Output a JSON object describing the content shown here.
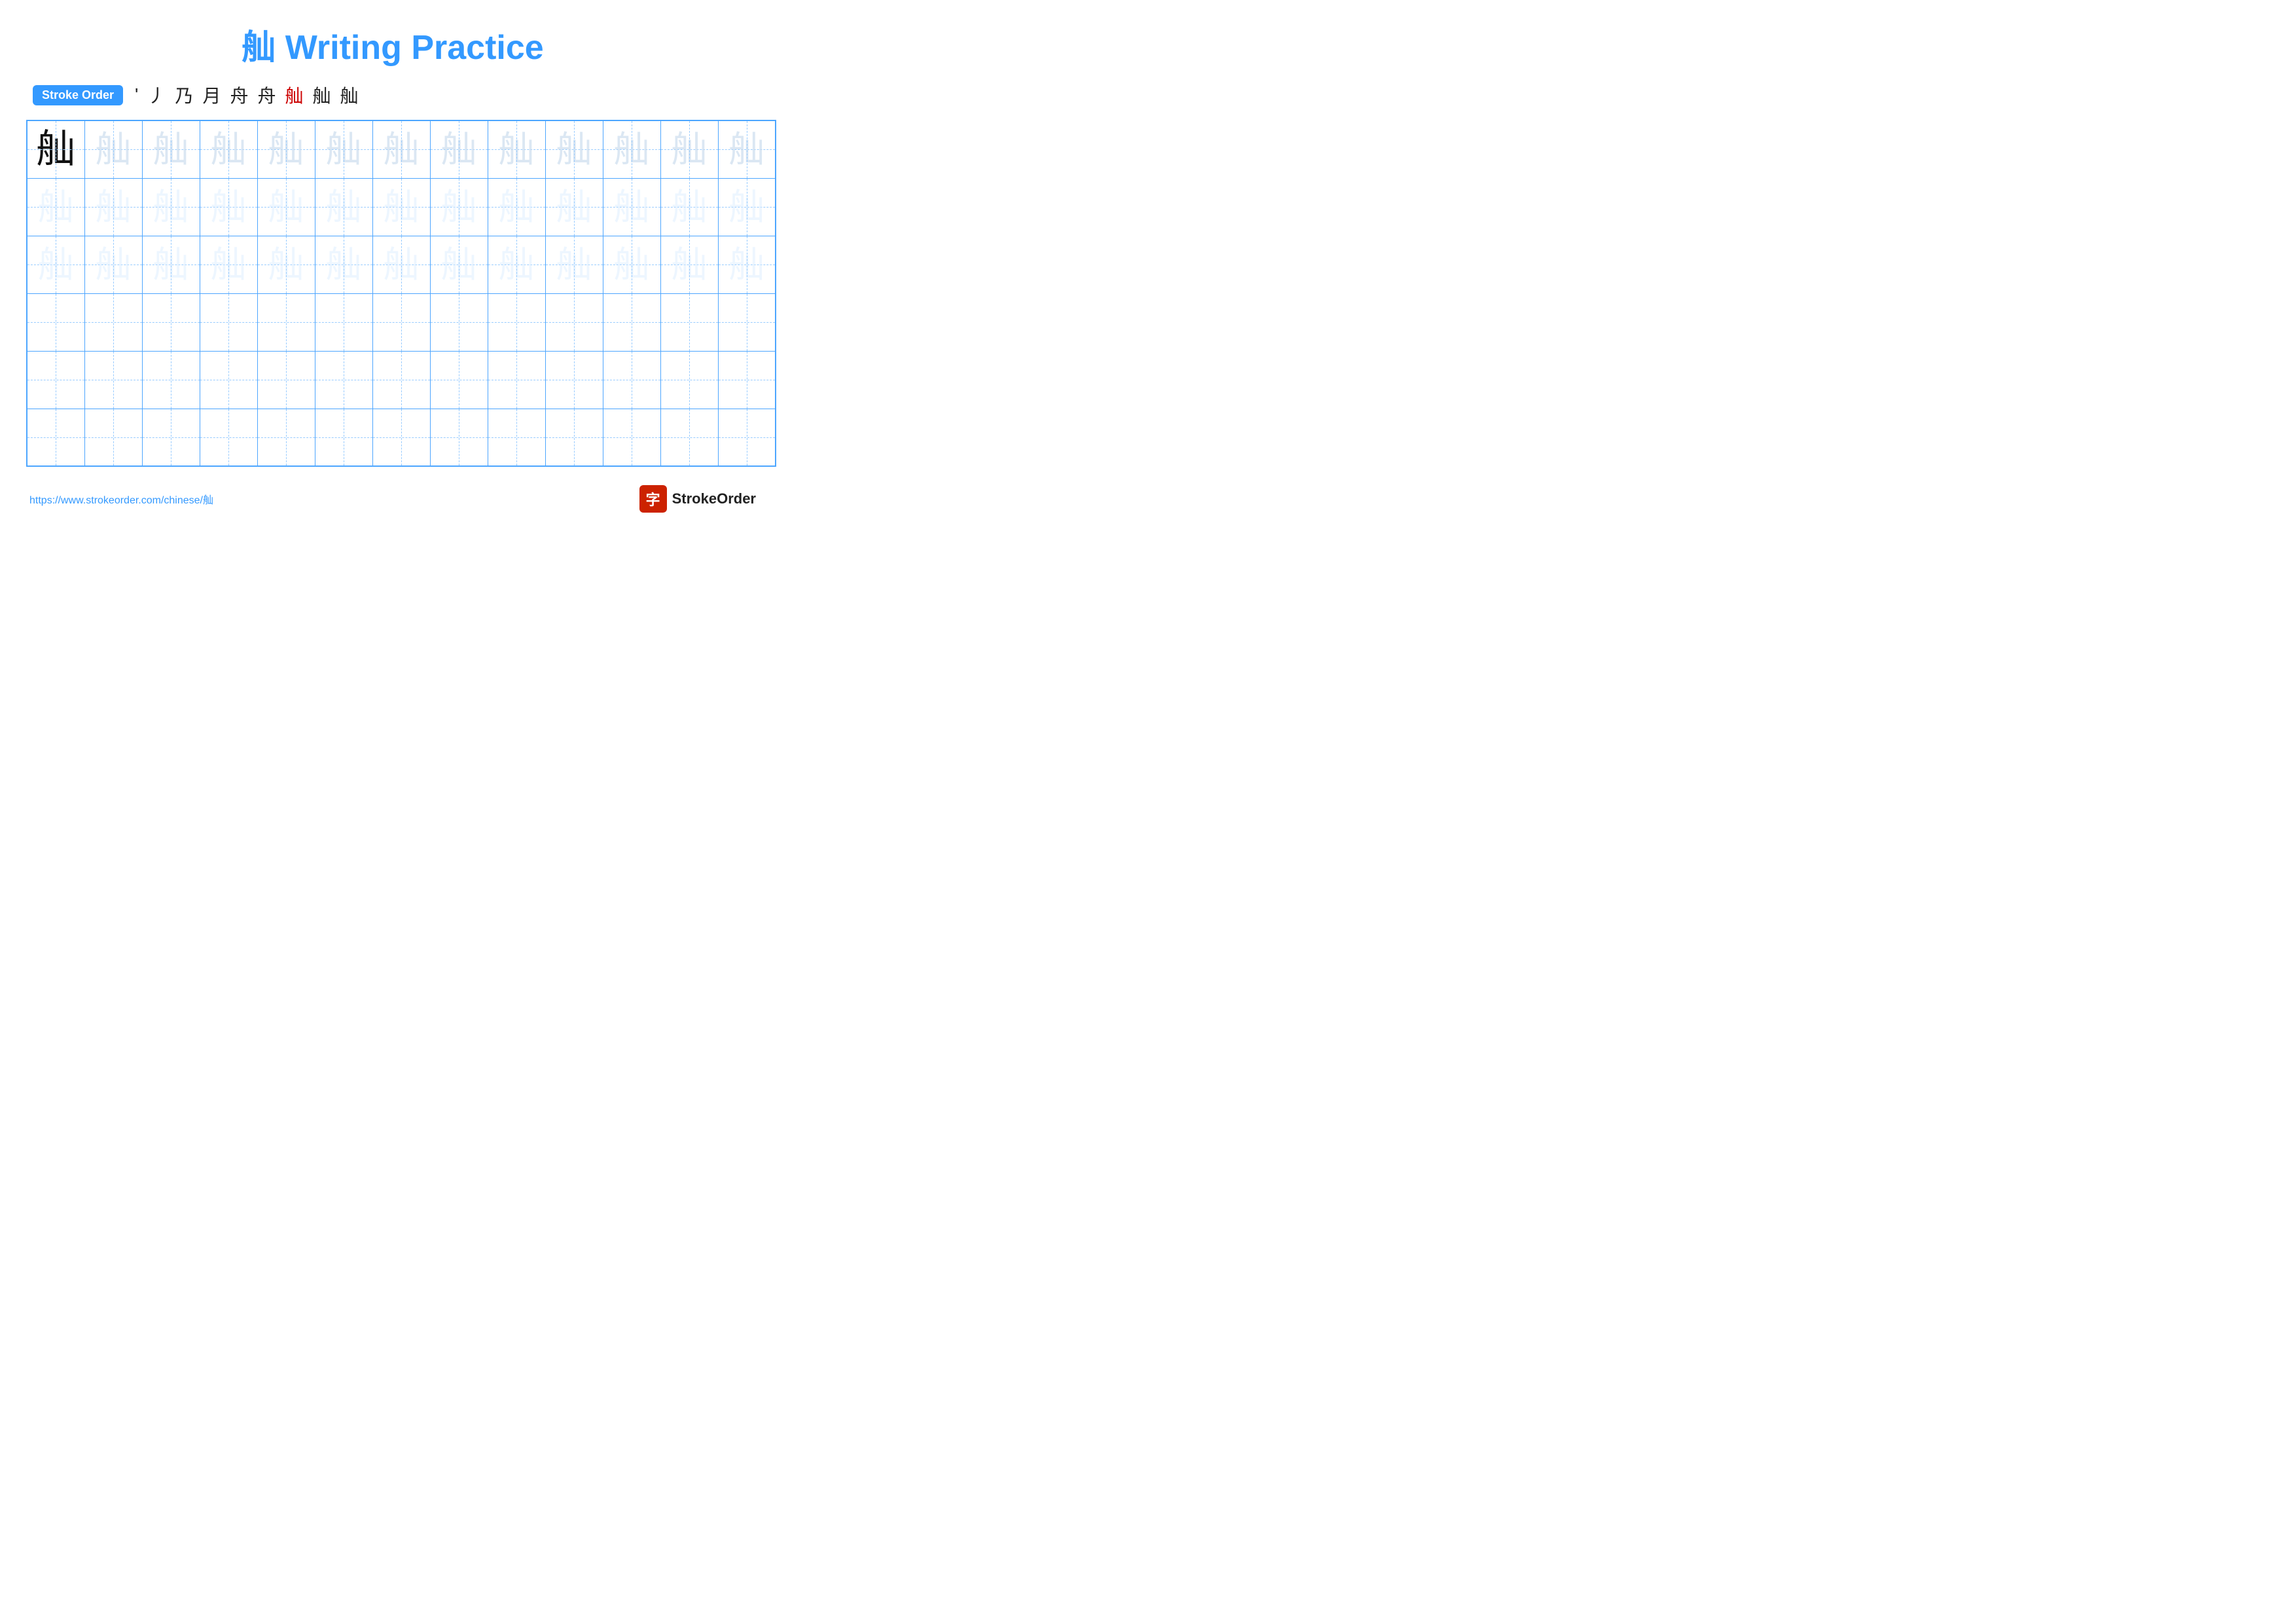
{
  "page": {
    "title": "舢 Writing Practice",
    "title_char": "舢",
    "title_text": "Writing Practice"
  },
  "stroke_order": {
    "badge_label": "Stroke Order",
    "strokes": [
      "'",
      "㇀",
      "乃",
      "月",
      "舟",
      "舟",
      "舢",
      "舢",
      "舢"
    ]
  },
  "grid": {
    "rows": 6,
    "cols": 13,
    "char": "舢",
    "row1_dark_first": true
  },
  "footer": {
    "url": "https://www.strokeorder.com/chinese/舢",
    "brand_char": "字",
    "brand_name": "StrokeOrder"
  }
}
